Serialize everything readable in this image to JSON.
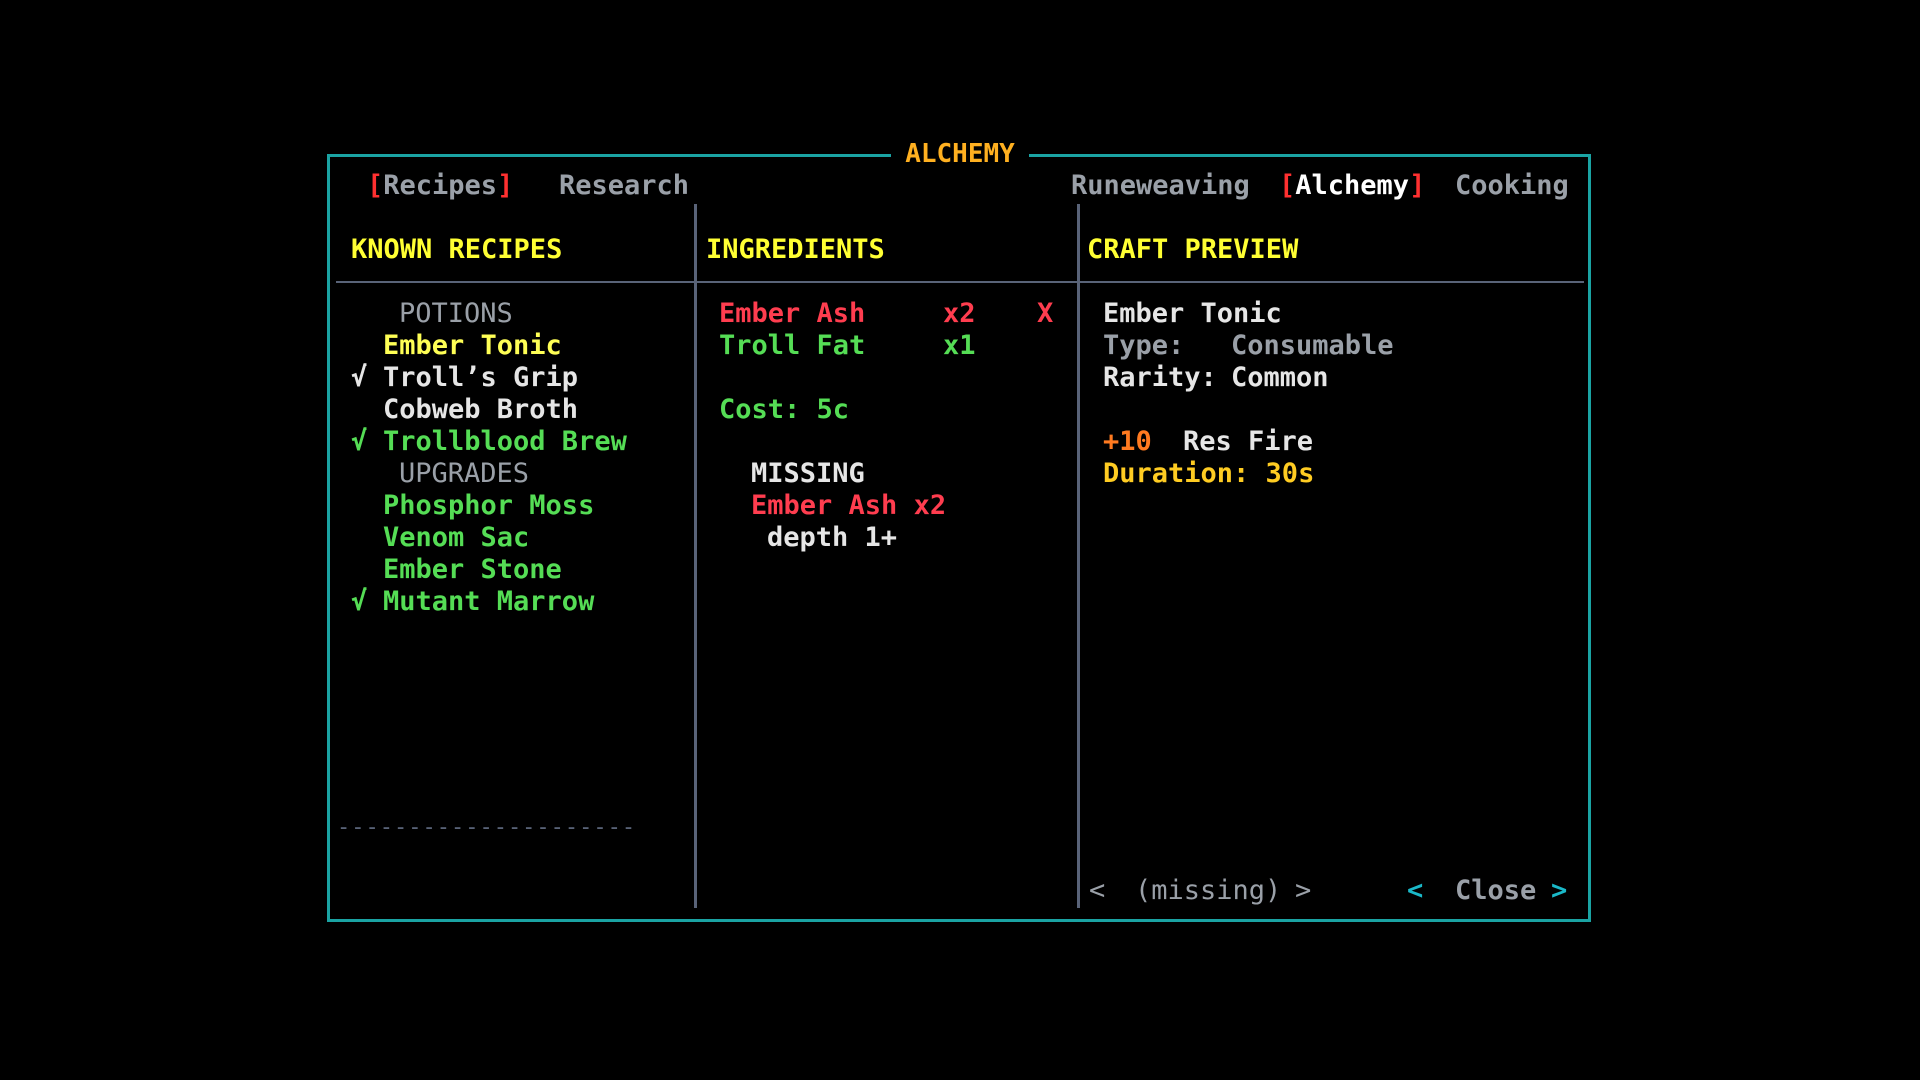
{
  "window": {
    "title": "ALCHEMY"
  },
  "colors": {
    "frame": "#1aa3a3",
    "title": "#ffb020",
    "header": "#ffff33",
    "ok": "#55dd55",
    "missing": "#ff3d4f",
    "selected": "#ffff55",
    "divider": "#596378"
  },
  "left_tabs": [
    {
      "label": "Recipes",
      "active": true
    },
    {
      "label": "Research",
      "active": false
    }
  ],
  "right_tabs": [
    {
      "label": "Runeweaving",
      "active": false
    },
    {
      "label": "Alchemy",
      "active": true
    },
    {
      "label": "Cooking",
      "active": false
    }
  ],
  "bracket_open": "[",
  "bracket_close": "]",
  "columns": {
    "recipes_header": "KNOWN RECIPES",
    "ingredients_header": "INGREDIENTS",
    "preview_header": "CRAFT PREVIEW"
  },
  "check_mark": "√",
  "recipes": {
    "categories": [
      "POTIONS",
      "UPGRADES"
    ],
    "potions": [
      {
        "name": "Ember Tonic",
        "checked": false,
        "state": "selected"
      },
      {
        "name": "Troll’s Grip",
        "checked": true,
        "state": "unavailable"
      },
      {
        "name": "Cobweb Broth",
        "checked": false,
        "state": "unavailable"
      },
      {
        "name": "Trollblood Brew",
        "checked": true,
        "state": "available"
      }
    ],
    "upgrades": [
      {
        "name": "Phosphor Moss",
        "checked": false,
        "state": "available"
      },
      {
        "name": "Venom Sac",
        "checked": false,
        "state": "available"
      },
      {
        "name": "Ember Stone",
        "checked": false,
        "state": "available"
      },
      {
        "name": "Mutant Marrow",
        "checked": true,
        "state": "available"
      }
    ],
    "divider": "---------------------"
  },
  "ingredients": {
    "items": [
      {
        "name": "Ember Ash",
        "qty": "x2",
        "status_icon": "X",
        "missing": true
      },
      {
        "name": "Troll Fat",
        "qty": "x1",
        "status_icon": "",
        "missing": false
      }
    ],
    "cost": "Cost: 5c",
    "missing_label": "MISSING",
    "missing_items": [
      {
        "name": "Ember Ash",
        "qty": "x2",
        "note": "depth 1+"
      }
    ]
  },
  "preview": {
    "name": "Ember Tonic",
    "type_label": "Type:",
    "type_value": "Consumable",
    "rarity_label": "Rarity:",
    "rarity_value": "Common",
    "effect_value": "+10",
    "effect_name": "Res Fire",
    "duration": "Duration: 30s",
    "craft_state": "(missing)",
    "close_label": "Close",
    "arrow_left": "<",
    "arrow_right": ">"
  }
}
